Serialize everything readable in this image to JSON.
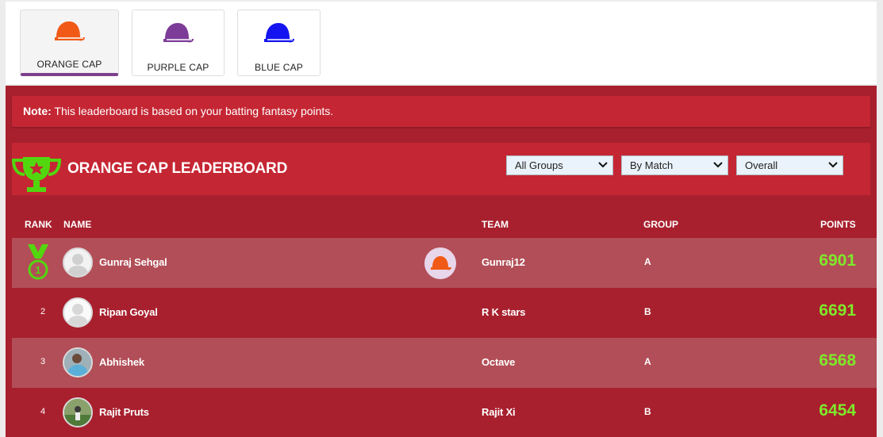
{
  "cap_tabs": [
    {
      "label": "ORANGE CAP",
      "color": "#f05a16",
      "active": true
    },
    {
      "label": "PURPLE CAP",
      "color": "#7d3c98",
      "active": false
    },
    {
      "label": "BLUE CAP",
      "color": "#1414f0",
      "active": false
    }
  ],
  "note": {
    "bold": "Note:",
    "text": " This leaderboard is based on your batting fantasy points."
  },
  "leaderboard": {
    "title": "ORANGE CAP LEADERBOARD",
    "filters": {
      "group": "All Groups",
      "mode": "By Match",
      "period": "Overall"
    }
  },
  "columns": {
    "rank": "RANK",
    "name": "NAME",
    "team": "TEAM",
    "group": "GROUP",
    "points": "POINTS"
  },
  "rows": [
    {
      "rank": "1",
      "name": "Gunraj Sehgal",
      "team": "Gunraj12",
      "group": "A",
      "points": "6901"
    },
    {
      "rank": "2",
      "name": "Ripan Goyal",
      "team": "R K stars",
      "group": "B",
      "points": "6691"
    },
    {
      "rank": "3",
      "name": "Abhishek",
      "team": "Octave",
      "group": "A",
      "points": "6568"
    },
    {
      "rank": "4",
      "name": "Rajit Pruts",
      "team": "Rajit Xi",
      "group": "B",
      "points": "6454"
    }
  ],
  "colors": {
    "accent": "#7ee92a",
    "header_bg": "#c52633",
    "panel_bg": "#a8202e",
    "row_alt": "#b24e57"
  }
}
